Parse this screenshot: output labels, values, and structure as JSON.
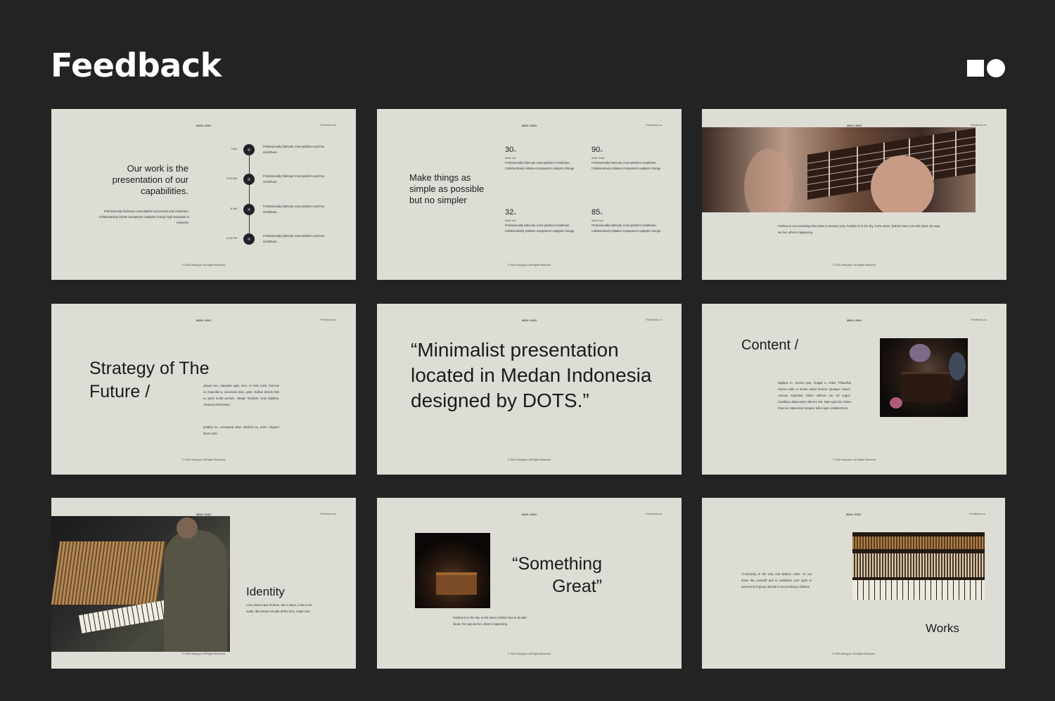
{
  "page": {
    "title": "Feedback"
  },
  "common": {
    "year": "2020 / 2021",
    "brand": "Feedback.co",
    "footer": "© 2020 dots grph. All Rights Reserved"
  },
  "slide1": {
    "headline": "Our work is the presentation of our capabilities.",
    "body": "Professionally fabricate cross-platform processes and mindshare. Collaboratively initiate transparent catalysts change high standards in networks.",
    "timeline": [
      {
        "time": "9 AM",
        "text": "Professionally fabricate cross-platform and fore mindshare."
      },
      {
        "time": "10:30 AM",
        "text": "Professionally fabricate cross-platform and fore mindshare."
      },
      {
        "time": "11 AM",
        "text": "Professionally fabricate cross-platform and fore mindshare."
      },
      {
        "time": "12:30 PM",
        "text": "Professionally fabricate cross-platform and fore mindshare."
      }
    ]
  },
  "slide2": {
    "headline": "Make things as simple as possible but no simpler",
    "unit": "%",
    "stats": [
      {
        "value": "30",
        "label": "Work One",
        "text": "Professionally fabricate cross-platform mindshare. Collaboratively initiative transparent catalysts change"
      },
      {
        "value": "90",
        "label": "Work Three",
        "text": "Professionally fabricate cross-platform mindshare. Collaboratively initiative transparent catalysts change"
      },
      {
        "value": "32",
        "label": "Work Two",
        "text": "Professionally fabricate cross-platform mindshare. Collaboratively initiative transparent catalysts change"
      },
      {
        "value": "85",
        "label": "Work Four",
        "text": "Professionally fabricate cross-platform mindshare. Collaboratively initiative transparent catalysts change"
      }
    ]
  },
  "slide3": {
    "text": "Fashion is not something that exists in dresses only. Fashion is in the sky, in the street, fashion has to do with ideas, the way we live, what is happening."
  },
  "slide4": {
    "headline": "Strategy of The Future /",
    "p1": "aliquet nec, vulputate eget, arcu. In enim justo, rhoncus ut, imperdiet a, venenatis vitae, justo. Nullam dictum felis eu pede mollis pretium. Integer tincidunt. Cras dapibus. Vivamus elementum",
    "p2": "porttitor eu, consequat vitae, eleifend ac, enim. Aliquam lorem ante."
  },
  "slide5": {
    "quote": "“Minimalist presentation located in Medan Indonesia designed by DOTS.”"
  },
  "slide6": {
    "headline": "Content /",
    "text": "dapibus in, viverra quis, feugiat a, tellus. Phasellus viverra nulla ut metus varius laoreet. Quisque rutrum. Aenean imperdiet. Etiam ultricies nisi vel augue. Curabitur ullamcorper ultricies nisi. Nam eget dui. Etiam rhoncus. Maecenas tempus, tellus eget condimentum."
  },
  "slide7": {
    "headline": "Identity",
    "text": "Love doesn't just sit there, like a stone, it has to be made, like bread; remade all the time, made new."
  },
  "slide8": {
    "quote": "“Something Great”",
    "text": "Fashion is in the sky, in the street, fashion has to do with ideas, the way we live, what is happening."
  },
  "slide9": {
    "quote": "“Conformity is the only real fashion crime. To not dress like yourself and to sublimate your spirit to some kind of group identity is succumbing to fashion",
    "headline": "Works"
  }
}
